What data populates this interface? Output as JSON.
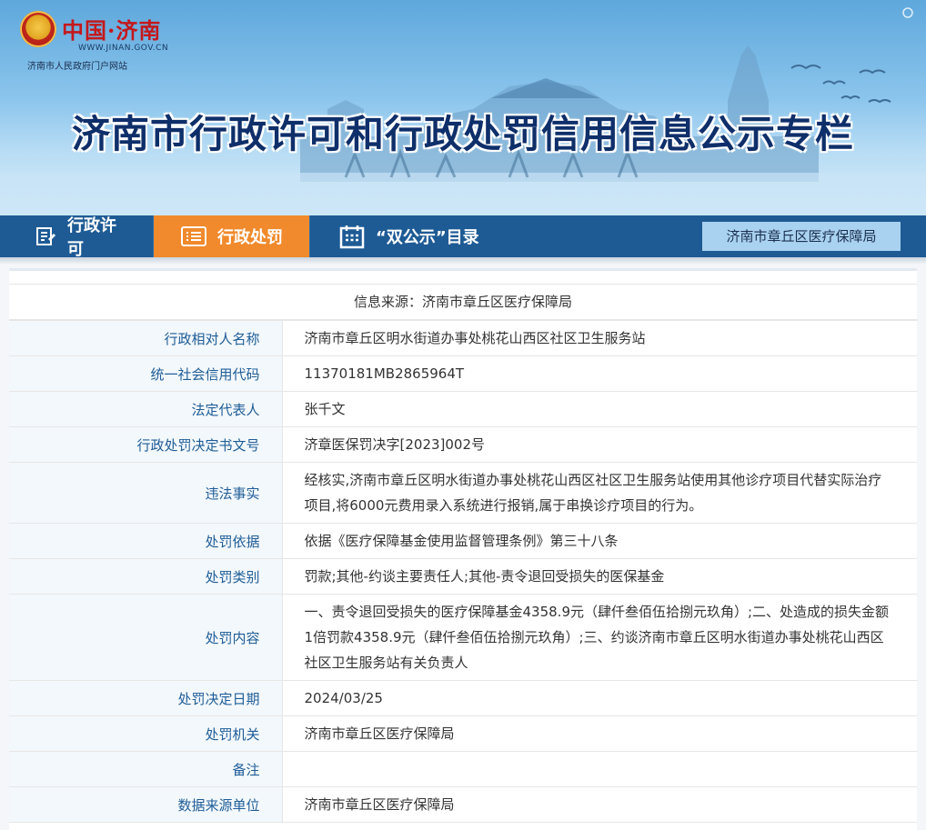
{
  "header": {
    "logo_name": "中国·济南",
    "logo_url": "WWW.JINAN.GOV.CN",
    "logo_sub": "济南市人民政府门户网站",
    "title": "济南市行政许可和行政处罚信用信息公示专栏"
  },
  "nav": {
    "items": [
      {
        "label": "行政许可",
        "icon": "edit-document-icon"
      },
      {
        "label": "行政处罚",
        "icon": "list-icon",
        "active": true
      },
      {
        "label": "“双公示”目录",
        "icon": "calendar-icon"
      }
    ],
    "source_button": "济南市章丘区医疗保障局"
  },
  "info": {
    "source_line": "信息来源：济南市章丘区医疗保障局",
    "rows": [
      {
        "label": "行政相对人名称",
        "value": "济南市章丘区明水街道办事处桃花山西区社区卫生服务站"
      },
      {
        "label": "统一社会信用代码",
        "value": "11370181MB2865964T"
      },
      {
        "label": "法定代表人",
        "value": "张千文"
      },
      {
        "label": "行政处罚决定书文号",
        "value": "济章医保罚决字[2023]002号"
      },
      {
        "label": "违法事实",
        "value": "经核实,济南市章丘区明水街道办事处桃花山西区社区卫生服务站使用其他诊疗项目代替实际治疗项目,将6000元费用录入系统进行报销,属于串换诊疗项目的行为。"
      },
      {
        "label": "处罚依据",
        "value": "依据《医疗保障基金使用监督管理条例》第三十八条"
      },
      {
        "label": "处罚类别",
        "value": "罚款;其他-约谈主要责任人;其他-责令退回受损失的医保基金"
      },
      {
        "label": "处罚内容",
        "value": "一、责令退回受损失的医疗保障基金4358.9元（肆仟叁佰伍拾捌元玖角）;二、处造成的损失金额1倍罚款4358.9元（肆仟叁佰伍拾捌元玖角）;三、约谈济南市章丘区明水街道办事处桃花山西区社区卫生服务站有关负责人"
      },
      {
        "label": "处罚决定日期",
        "value": "2024/03/25"
      },
      {
        "label": "处罚机关",
        "value": "济南市章丘区医疗保障局"
      },
      {
        "label": "备注",
        "value": ""
      },
      {
        "label": "数据来源单位",
        "value": "济南市章丘区医疗保障局"
      }
    ]
  },
  "colors": {
    "nav_bg": "#1e5b95",
    "nav_active": "#f08a2c",
    "label_text": "#1f5d97",
    "title_text": "#0f2f6a"
  }
}
